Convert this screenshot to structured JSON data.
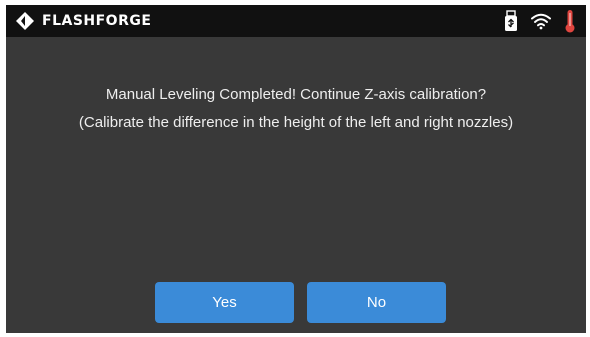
{
  "header": {
    "brand": "FLASHFORGE",
    "icons": [
      "flashforge-logo-icon",
      "usb-drive-icon",
      "wifi-icon",
      "thermometer-icon"
    ]
  },
  "dialog": {
    "line1": "Manual Leveling Completed! Continue Z-axis calibration?",
    "line2": "(Calibrate the difference in the height of the left and right nozzles)"
  },
  "buttons": {
    "yes": "Yes",
    "no": "No"
  },
  "colors": {
    "background": "#393939",
    "topbar": "#111111",
    "button": "#3b8bd8",
    "thermometer": "#e0453f"
  }
}
